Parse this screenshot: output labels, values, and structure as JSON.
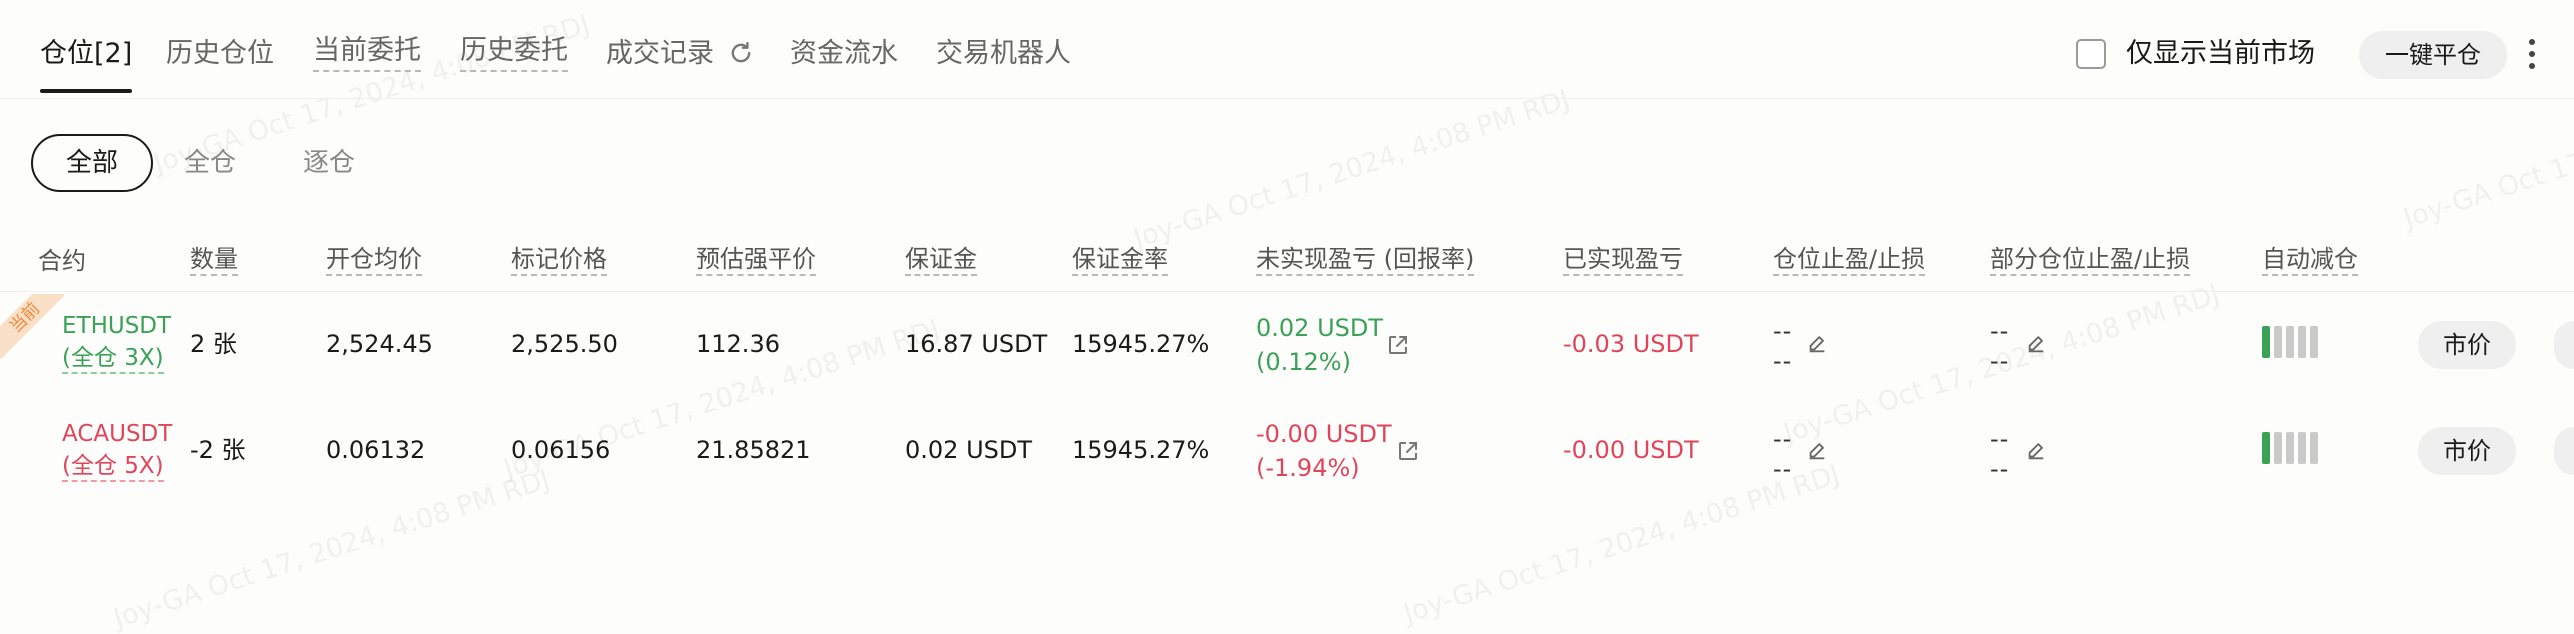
{
  "tabs": [
    {
      "label": "仓位[2]",
      "active": true
    },
    {
      "label": "历史仓位"
    },
    {
      "label": "当前委托"
    },
    {
      "label": "历史委托"
    },
    {
      "label": "成交记录"
    },
    {
      "label": "资金流水"
    },
    {
      "label": "交易机器人"
    }
  ],
  "toolbar": {
    "only_current_market_label": "仅显示当前市场",
    "only_current_market_checked": false,
    "close_all_label": "一键平仓"
  },
  "filters": [
    {
      "label": "全部",
      "selected": true
    },
    {
      "label": "全仓"
    },
    {
      "label": "逐仓"
    }
  ],
  "table": {
    "headers": [
      "合约",
      "数量",
      "开仓均价",
      "标记价格",
      "预估强平价",
      "保证金",
      "保证金率",
      "未实现盈亏 (回报率)",
      "已实现盈亏",
      "仓位止盈/止损",
      "部分仓位止盈/止损",
      "自动减仓"
    ],
    "rows": [
      {
        "badge": "当前",
        "symbol": "ETHUSDT",
        "mode": "(全仓 3X)",
        "side": "long",
        "qty": "2 张",
        "entry": "2,524.45",
        "mark": "2,525.50",
        "liq": "112.36",
        "margin": "16.87 USDT",
        "margin_rate": "15945.27%",
        "upnl": "0.02 USDT",
        "roe": "(0.12%)",
        "rpnl": "-0.03 USDT",
        "tpsl_tp": "--",
        "tpsl_sl": "--",
        "partial_tp": "--",
        "partial_sl": "--",
        "adl_level": 1,
        "action": "市价"
      },
      {
        "symbol": "ACAUSDT",
        "mode": "(全仓 5X)",
        "side": "short",
        "qty": "-2 张",
        "entry": "0.06132",
        "mark": "0.06156",
        "liq": "21.85821",
        "margin": "0.02 USDT",
        "margin_rate": "15945.27%",
        "upnl": "-0.00 USDT",
        "roe": "(-1.94%)",
        "rpnl": "-0.00 USDT",
        "tpsl_tp": "--",
        "tpsl_sl": "--",
        "partial_tp": "--",
        "partial_sl": "--",
        "adl_level": 1,
        "action": "市价"
      }
    ]
  },
  "watermark": "Joy-GA Oct 17, 2024, 4:08 PM RDJ",
  "colors": {
    "profit": "#3aa257",
    "loss": "#e0455b",
    "accent": "#1a1a1a",
    "badge_bg": "#fbe0c8",
    "badge_text": "#f08a3c"
  }
}
